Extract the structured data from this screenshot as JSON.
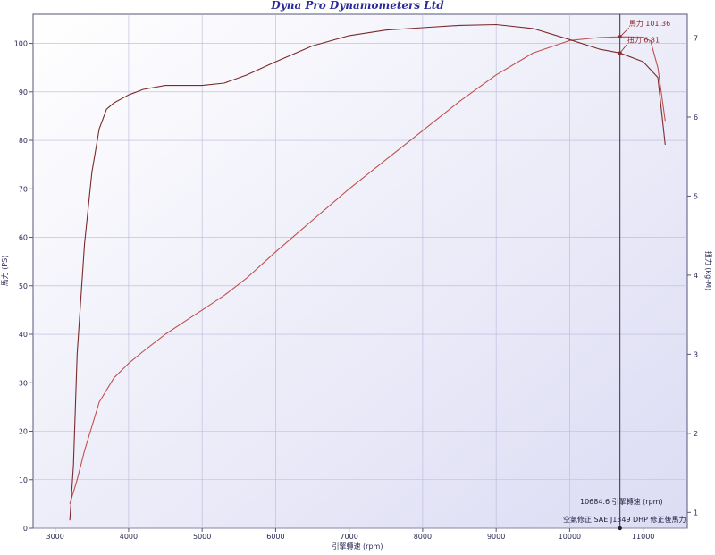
{
  "chart_data": {
    "type": "line",
    "title": "Dyna Pro Dynamometers Ltd",
    "xlabel": "引擎轉速 (rpm)",
    "ylabel_left": "馬力 (PS)",
    "ylabel_right": "扭力 (kg-M)",
    "xlim": [
      2700,
      11600
    ],
    "ylim_left": [
      0,
      106
    ],
    "ylim_right": [
      0.8,
      7.3
    ],
    "x_ticks": [
      3000,
      4000,
      5000,
      6000,
      7000,
      8000,
      9000,
      10000,
      11000
    ],
    "y_left_ticks": [
      0,
      10,
      20,
      30,
      40,
      50,
      60,
      70,
      80,
      90,
      100
    ],
    "y_right_ticks": [
      1,
      2,
      3,
      4,
      5,
      6,
      7
    ],
    "grid": true,
    "series": [
      {
        "name": "馬力",
        "axis": "left",
        "color": "#c0504d",
        "x": [
          3200,
          3300,
          3400,
          3500,
          3600,
          3800,
          4000,
          4200,
          4500,
          4800,
          5000,
          5300,
          5600,
          6000,
          6500,
          7000,
          7500,
          8000,
          8500,
          9000,
          9500,
          10000,
          10400,
          10685,
          11000,
          11100,
          11200,
          11300
        ],
        "values": [
          5,
          10,
          16,
          21,
          26,
          31,
          34,
          36.5,
          40,
          43,
          45,
          48,
          51.5,
          57,
          63.5,
          70,
          76,
          82,
          88,
          93.5,
          98,
          100.6,
          101.2,
          101.36,
          101.3,
          100.5,
          95,
          84
        ]
      },
      {
        "name": "扭力",
        "axis": "right",
        "color": "#7a2a2a",
        "x": [
          3200,
          3250,
          3300,
          3400,
          3500,
          3600,
          3700,
          3800,
          4000,
          4200,
          4500,
          4800,
          5000,
          5300,
          5600,
          6000,
          6500,
          7000,
          7500,
          8000,
          8500,
          9000,
          9500,
          10000,
          10400,
          10685,
          11000,
          11200,
          11300
        ],
        "values": [
          0.9,
          1.6,
          3.0,
          4.4,
          5.3,
          5.85,
          6.1,
          6.18,
          6.28,
          6.35,
          6.4,
          6.4,
          6.4,
          6.43,
          6.53,
          6.7,
          6.9,
          7.03,
          7.1,
          7.13,
          7.16,
          7.17,
          7.12,
          6.98,
          6.86,
          6.81,
          6.7,
          6.5,
          5.65
        ]
      }
    ],
    "cursor": {
      "rpm": 10684.6,
      "readout": "10684.6 引擎轉速 (rpm)",
      "hp_label": "馬力 101.36",
      "hp_value": 101.36,
      "tq_label": "扭力 6.81",
      "tq_value": 6.81
    },
    "footer": {
      "correction": "空氣修正 SAE J1349",
      "mode": "DHP 修正後馬力"
    }
  }
}
